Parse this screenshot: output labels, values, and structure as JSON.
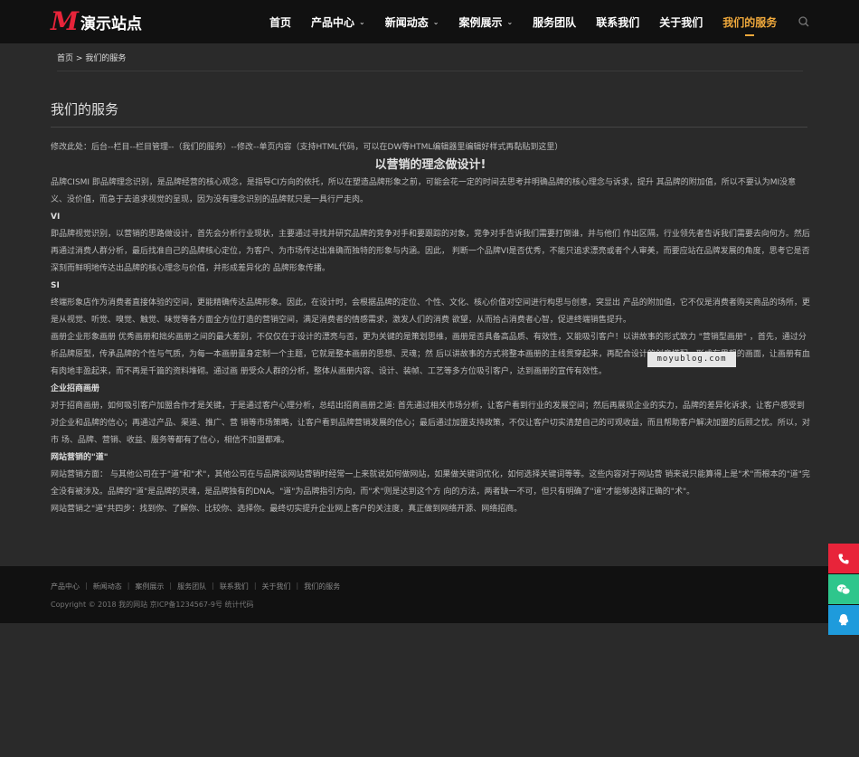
{
  "brand": {
    "logo_mark": "M",
    "name": "演示站点"
  },
  "nav": {
    "items": [
      {
        "label": "首页",
        "has_dropdown": false,
        "active": false
      },
      {
        "label": "产品中心",
        "has_dropdown": true,
        "active": false
      },
      {
        "label": "新闻动态",
        "has_dropdown": true,
        "active": false
      },
      {
        "label": "案例展示",
        "has_dropdown": true,
        "active": false
      },
      {
        "label": "服务团队",
        "has_dropdown": false,
        "active": false
      },
      {
        "label": "联系我们",
        "has_dropdown": false,
        "active": false
      },
      {
        "label": "关于我们",
        "has_dropdown": false,
        "active": false
      },
      {
        "label": "我们的服务",
        "has_dropdown": false,
        "active": true
      }
    ],
    "search_icon": "search-icon"
  },
  "breadcrumb": {
    "home": "首页",
    "separator": ">",
    "current": "我们的服务"
  },
  "page_title": "我们的服务",
  "content": {
    "edit_note": "修改此处：后台--栏目--栏目管理--（我们的服务）--修改--单页内容（支持HTML代码，可以在DW等HTML编辑器里编辑好样式再黏贴到这里）",
    "headline": "以营销的理念做设计!",
    "p1": "品牌CISMI  即品牌理念识别，是品牌经营的核心观念，是指导CI方向的依托，所以在塑造品牌形象之前，可能会花一定的时间去思考并明确品牌的核心理念与诉求，提升 其品牌的附加值，所以不要认为MI没意义、没价值，而急于去追求视觉的呈现，因为没有理念识别的品牌就只是一具行尸走肉。",
    "h_vi": "VI",
    "p_vi": "即品牌视觉识别，以营销的思路做设计，首先会分析行业现状，主要通过寻找并研究品牌的竞争对手和要跟踪的对象，竞争对手告诉我们需要打倒谁，并与他们 作出区隔，行业领先者告诉我们需要去向何方。然后再通过消费人群分析，最后找准自己的品牌核心定位，为客户、为市场传达出准确而独特的形象与内涵。因此， 判断一个品牌VI是否优秀，不能只追求漂亮或者个人审美，而要应站在品牌发展的角度，思考它是否深刻而鲜明地传达出品牌的核心理念与价值，并形成差异化的 品牌形象传播。",
    "h_si": "SI",
    "p_si": "终端形象店作为消费者直接体验的空间，更能精确传达品牌形象。因此，在设计时，会根据品牌的定位、个性、文化、核心价值对空间进行构思与创意，突显出 产品的附加值，它不仅是消费者购买商品的场所，更是从视觉、听觉、嗅觉、触觉、味觉等各方面全方位打造的营销空间，满足消费者的情感需求，激发人们的消费 欲望，从而拾占消费者心智，促进终端销售提升。",
    "p_album": "画册企业形象画册 优秀画册和拙劣画册之间的最大差别，不仅仅在于设计的漂亮与否，更为关键的是策划思维，画册是否具备高品质、有效性，又能吸引客户！以讲故事的形式致力 \"营销型画册\" ，首先，通过分析品牌原型，传承品牌的个性与气质，为每一本画册量身定制一个主题，它就是整本画册的思想、灵魂；然 后以讲故事的方式将整本画册的主线贯穿起来，再配合设计的创意搭配，形成有思想的画面，让画册有血有肉地丰盈起来，而不再是千篇的资料堆砌。通过画 册受众人群的分析，整体从画册内容、设计、装帧、工艺等多方位吸引客户，达到画册的宣传有效性。",
    "h_invest": "企业招商画册",
    "p_invest": "对于招商画册，如何吸引客户加盟合作才是关键，于是通过客户心理分析，总结出招商画册之道: 首先通过相关市场分析，让客户看到行业的发展空间；然后再展现企业的实力，品牌的差异化诉求，让客户感受到对企业和品牌的信心；再通过产品、渠道、推广、营 销等市场策略，让客户看到品牌营销发展的信心；最后通过加盟支持政策，不仅让客户切实清楚自己的可观收益，而且帮助客户解决加盟的后顾之忧。所以，对市 场、品牌、营销、收益、服务等都有了信心，相信不加盟都难。",
    "h_web": "网站营销的\"道\"",
    "p_web1": "网站营销方面： 与其他公司在于\"道\"和\"术\"，其他公司在与品牌谈网站营销时经常一上来就说如何做网站，如果做关键词优化，如何选择关键词等等。这些内容对于网站营 销来说只能算得上是\"术\"而根本的\"道\"完全没有被涉及。品牌的\"道\"是品牌的灵魂，是品牌独有的DNA。\"道\"为品牌指引方向，而\"术\"则是达到这个方 向的方法，两者缺一不可，但只有明确了\"道\"才能够选择正确的\"术\"。",
    "p_web2": "网站营销之\"道\"共四步：找到你、了解你、比较你、选择你。最终切实提升企业网上客户的关注度，真正做到网络开源、网络招商。"
  },
  "watermark": "moyublog.com",
  "footer": {
    "links": [
      "产品中心",
      "新闻动态",
      "案例展示",
      "服务团队",
      "联系我们",
      "关于我们",
      "我们的服务"
    ],
    "separator": "|",
    "copyright": "Copyright © 2018 我的网站 京ICP备1234567-9号 统计代码"
  },
  "side_buttons": [
    {
      "icon": "phone-icon",
      "color": "#e8243a"
    },
    {
      "icon": "wechat-icon",
      "color": "#2ec68c"
    },
    {
      "icon": "qq-icon",
      "color": "#1e9bdc"
    }
  ],
  "colors": {
    "accent": "#f0a93c",
    "brand_red": "#e8243a",
    "header_bg": "#111111",
    "page_bg": "#2a2a2a"
  }
}
